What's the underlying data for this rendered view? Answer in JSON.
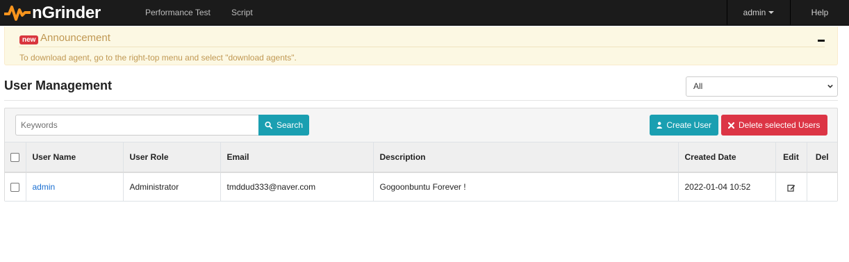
{
  "navbar": {
    "brand": "nGrinder",
    "links": [
      "Performance Test",
      "Script"
    ],
    "user_menu": "admin",
    "help": "Help"
  },
  "announcement": {
    "badge": "new",
    "title": "Announcement",
    "message": "To download agent, go to the right-top menu and select \"download agents\"."
  },
  "page": {
    "title": "User Management",
    "role_filter": "All"
  },
  "toolbar": {
    "search_placeholder": "Keywords",
    "search_label": "Search",
    "create_label": "Create User",
    "delete_label": "Delete selected Users"
  },
  "table": {
    "headers": {
      "user_name": "User Name",
      "user_role": "User Role",
      "email": "Email",
      "description": "Description",
      "created_date": "Created Date",
      "edit": "Edit",
      "del": "Del"
    },
    "rows": [
      {
        "user_name": "admin",
        "user_role": "Administrator",
        "email": "tmddud333@naver.com",
        "description": "Gogoonbuntu Forever !",
        "created_date": "2022-01-04 10:52"
      }
    ]
  },
  "colors": {
    "navbar_bg": "#1b1b1b",
    "brand_orange": "#f7941d",
    "accent_teal": "#1a9fb1",
    "danger_red": "#dc3545",
    "announce_bg": "#fcf8e3",
    "announce_text": "#c09853",
    "link_blue": "#1a6fd1"
  },
  "icons": {
    "search": "search-icon",
    "create": "user-icon",
    "delete": "times-icon",
    "edit": "edit-icon",
    "collapse": "minus-icon"
  }
}
